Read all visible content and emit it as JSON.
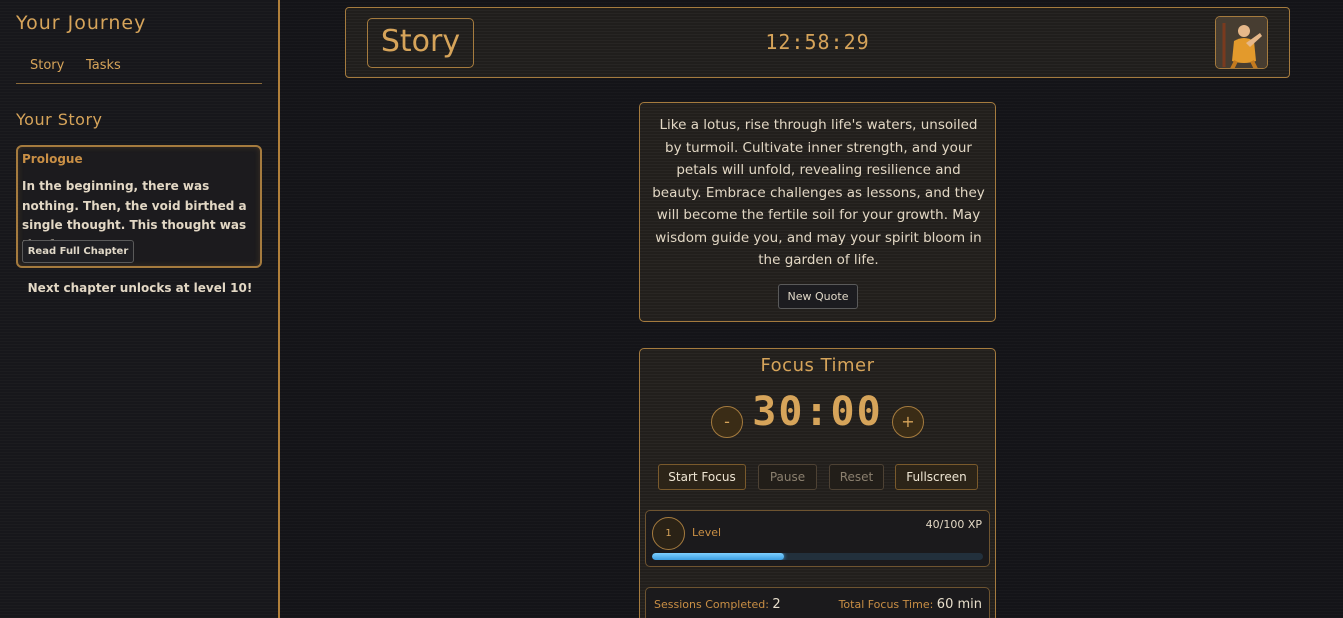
{
  "sidebar": {
    "title": "Your Journey",
    "nav": [
      "Story",
      "Tasks"
    ],
    "section_title": "Your Story",
    "chapter": {
      "title": "Prologue",
      "excerpt": "In the beginning, there was nothing. Then, the void birthed a single thought. This thought was the f...",
      "read_button": "Read Full Chapter"
    },
    "next_unlock": "Next chapter unlocks at level 10!"
  },
  "header": {
    "title": "Story",
    "clock": "12:58:29",
    "avatar_icon": "monk-avatar-icon"
  },
  "quote": {
    "text": "Like a lotus, rise through life's waters, unsoiled by turmoil. Cultivate inner strength, and your petals will unfold, revealing resilience and beauty. Embrace challenges as lessons, and they will become the fertile soil for your growth. May wisdom guide you, and may your spirit bloom in the garden of life.",
    "button": "New Quote"
  },
  "timer": {
    "title": "Focus Timer",
    "display": "30:00",
    "minus": "-",
    "plus": "+",
    "buttons": {
      "start": "Start Focus",
      "pause": "Pause",
      "reset": "Reset",
      "fullscreen": "Fullscreen"
    },
    "level": {
      "number": "1",
      "label": "Level",
      "xp_text": "40/100 XP",
      "xp_progress": 0.4
    },
    "stats": {
      "sessions_label": "Sessions Completed:",
      "sessions_value": "2",
      "focus_label": "Total Focus Time:",
      "focus_value": "60 min"
    }
  },
  "colors": {
    "accent": "#d6a45a",
    "border": "#a57b3e",
    "xp_bar": "#3b9de0"
  }
}
